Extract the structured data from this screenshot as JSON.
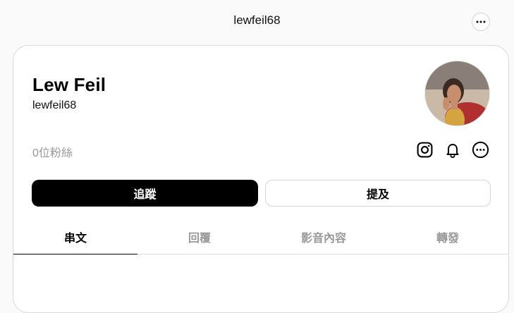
{
  "header": {
    "title": "lewfeil68",
    "more_icon": "more-horizontal-icon"
  },
  "profile": {
    "name": "Lew Feil",
    "handle": "lewfeil68",
    "followers": "0位粉絲",
    "avatar": "profile-photo"
  },
  "actions": {
    "icons": [
      "instagram-icon",
      "bell-icon",
      "more-horizontal-icon"
    ],
    "follow_label": "追蹤",
    "mention_label": "提及"
  },
  "tabs": [
    {
      "label": "串文",
      "active": true
    },
    {
      "label": "回覆",
      "active": false
    },
    {
      "label": "影音內容",
      "active": false
    },
    {
      "label": "轉發",
      "active": false
    }
  ],
  "colors": {
    "background": "#fafafa",
    "card": "#ffffff",
    "primary": "#000000",
    "muted": "#999999"
  }
}
